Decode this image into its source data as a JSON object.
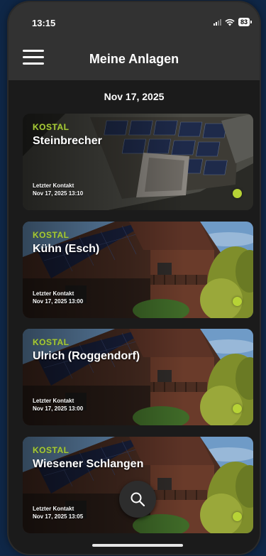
{
  "status_bar": {
    "time": "13:15",
    "battery": "83",
    "icons": [
      "signal-icon",
      "wifi-icon",
      "battery-icon"
    ]
  },
  "header": {
    "title": "Meine Anlagen",
    "menu_icon": "hamburger-menu-icon"
  },
  "date": "Nov 17, 2025",
  "colors": {
    "brand_green": "#a6c73a",
    "status_green": "#b7d336",
    "background": "#1b1b1b",
    "header": "#323232"
  },
  "plants": [
    {
      "brand": "KOSTAL",
      "name": "Steinbrecher",
      "contact_label": "Letzter Kontakt",
      "contact_time": "Nov 17, 2025 13:10",
      "image": "rooftop-solar-panels"
    },
    {
      "brand": "KOSTAL",
      "name": "Kühn (Esch)",
      "contact_label": "Letzter Kontakt",
      "contact_time": "Nov 17, 2025 13:00",
      "image": "house-with-solar-roof"
    },
    {
      "brand": "KOSTAL",
      "name": "Ulrich (Roggendorf)",
      "contact_label": "Letzter Kontakt",
      "contact_time": "Nov 17, 2025 13:00",
      "image": "house-with-solar-roof"
    },
    {
      "brand": "KOSTAL",
      "name": "Wiesener Schlangen",
      "contact_label": "Letzter Kontakt",
      "contact_time": "Nov 17, 2025 13:05",
      "image": "house-with-solar-roof"
    }
  ],
  "search_button_icon": "search-icon"
}
